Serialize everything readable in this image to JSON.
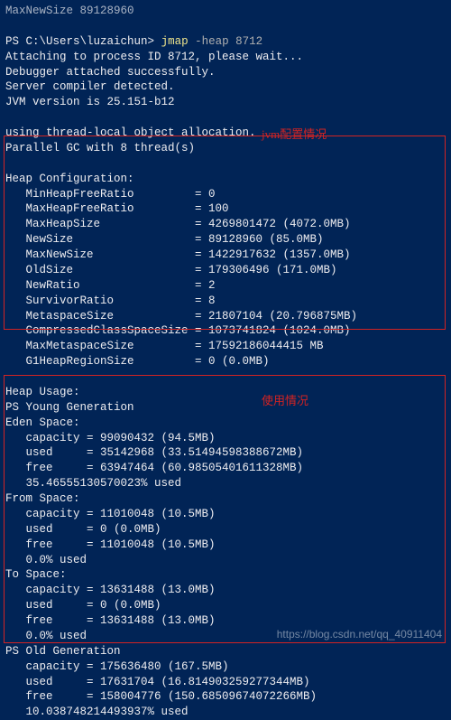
{
  "preline": "MaxNewSize 89128960",
  "prompt": {
    "prefix": "PS ",
    "path": "C:\\Users\\luzaichun",
    "sep": "> ",
    "cmd": "jmap",
    "args": " -heap 8712"
  },
  "header": [
    "Attaching to process ID 8712, please wait...",
    "Debugger attached successfully.",
    "Server compiler detected.",
    "JVM version is 25.151-b12",
    "",
    "using thread-local object allocation.",
    "Parallel GC with 8 thread(s)",
    ""
  ],
  "annot": {
    "config": "jvm配置情况",
    "usage": "使用情况"
  },
  "heapConfig": {
    "title": "Heap Configuration:",
    "rows": [
      [
        "MinHeapFreeRatio",
        "0"
      ],
      [
        "MaxHeapFreeRatio",
        "100"
      ],
      [
        "MaxHeapSize",
        "4269801472 (4072.0MB)"
      ],
      [
        "NewSize",
        "89128960 (85.0MB)"
      ],
      [
        "MaxNewSize",
        "1422917632 (1357.0MB)"
      ],
      [
        "OldSize",
        "179306496 (171.0MB)"
      ],
      [
        "NewRatio",
        "2"
      ],
      [
        "SurvivorRatio",
        "8"
      ],
      [
        "MetaspaceSize",
        "21807104 (20.796875MB)"
      ],
      [
        "CompressedClassSpaceSize",
        "1073741824 (1024.0MB)"
      ],
      [
        "MaxMetaspaceSize",
        "17592186044415 MB"
      ],
      [
        "G1HeapRegionSize",
        "0 (0.0MB)"
      ]
    ]
  },
  "heapUsage": {
    "title": "Heap Usage:",
    "young": "PS Young Generation",
    "eden": {
      "title": "Eden Space:",
      "capacity": "99090432 (94.5MB)",
      "used": "35142968 (33.51494598388672MB)",
      "free": "63947464 (60.98505401611328MB)",
      "pct": "35.46555130570023% used"
    },
    "from": {
      "title": "From Space:",
      "capacity": "11010048 (10.5MB)",
      "used": "0 (0.0MB)",
      "free": "11010048 (10.5MB)",
      "pct": "0.0% used"
    },
    "to": {
      "title": "To Space:",
      "capacity": "13631488 (13.0MB)",
      "used": "0 (0.0MB)",
      "free": "13631488 (13.0MB)",
      "pct": "0.0% used"
    },
    "oldTitle": "PS Old Generation",
    "old": {
      "capacity": "175636480 (167.5MB)",
      "used": "17631704 (16.814903259277344MB)",
      "free": "158004776 (150.68509674072266MB)",
      "pct": "10.038748214493937% used"
    }
  },
  "watermark": "https://blog.csdn.net/qq_40911404"
}
